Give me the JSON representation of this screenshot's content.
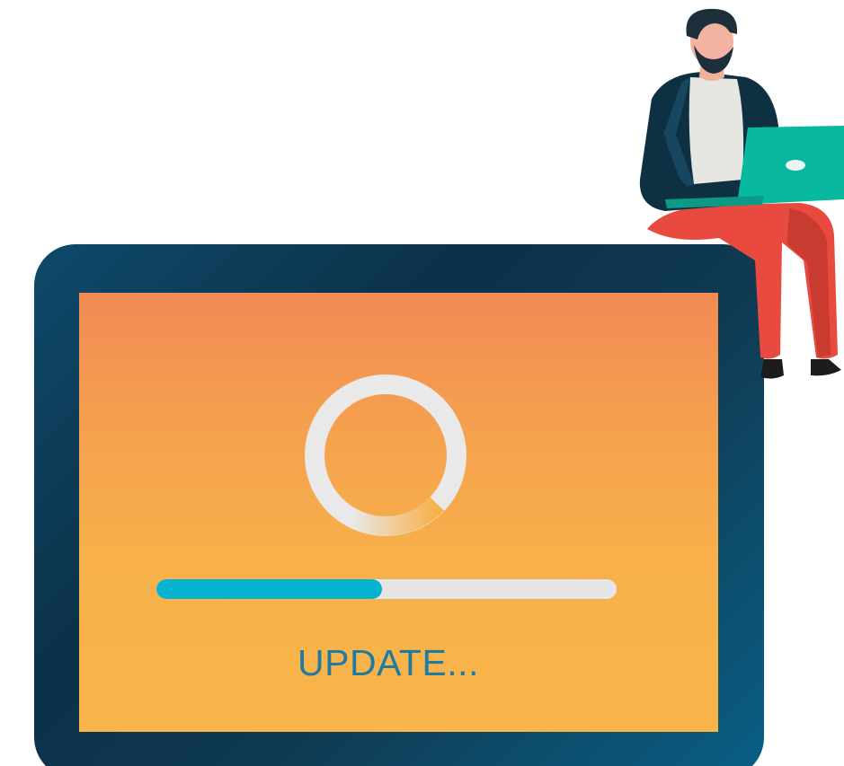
{
  "status": {
    "label": "UPDATE..."
  },
  "progress": {
    "fraction": 0.49
  },
  "spinner": {
    "arc_fraction": 0.22
  },
  "colors": {
    "device_frame": "#0b3148",
    "screen_top": "#f28a54",
    "screen_bottom": "#f8b549",
    "progress_fill": "#05b2cf",
    "progress_track": "#e6e6e6",
    "status_text": "#1f7c9e",
    "laptop": "#08b9a0",
    "trousers": "#e84a3f",
    "jacket": "#0e3043"
  },
  "icons": {
    "spinner": "loading-ring-icon",
    "person": "person-with-laptop-illustration"
  }
}
